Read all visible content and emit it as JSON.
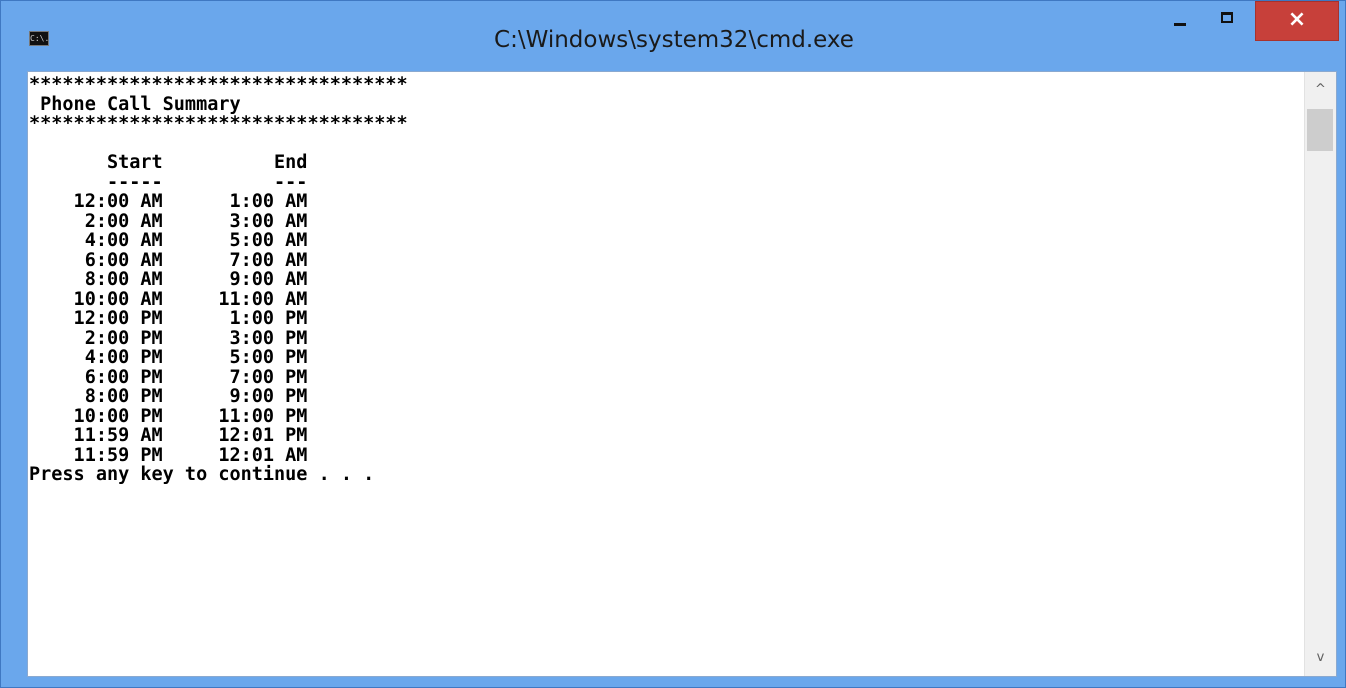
{
  "window": {
    "title": "C:\\Windows\\system32\\cmd.exe",
    "icon_text": "C:\\.",
    "icon": "console-app-icon",
    "buttons": {
      "minimize": "minimize-icon",
      "maximize": "maximize-icon",
      "close": "×"
    },
    "colors": {
      "titlebar": "#6aa7ec",
      "close_button": "#c7403a",
      "console_bg": "#ffffff",
      "console_text": "#000000"
    }
  },
  "console": {
    "lines": [
      "**********************************",
      " Phone Call Summary",
      "**********************************",
      "",
      "       Start          End",
      "       -----          ---",
      "    12:00 AM      1:00 AM",
      "     2:00 AM      3:00 AM",
      "     4:00 AM      5:00 AM",
      "     6:00 AM      7:00 AM",
      "     8:00 AM      9:00 AM",
      "    10:00 AM     11:00 AM",
      "    12:00 PM      1:00 PM",
      "     2:00 PM      3:00 PM",
      "     4:00 PM      5:00 PM",
      "     6:00 PM      7:00 PM",
      "     8:00 PM      9:00 PM",
      "    10:00 PM     11:00 PM",
      "    11:59 AM     12:01 PM",
      "    11:59 PM     12:01 AM",
      "Press any key to continue . . ."
    ]
  },
  "scrollbar": {
    "up": "^",
    "down": "v"
  }
}
